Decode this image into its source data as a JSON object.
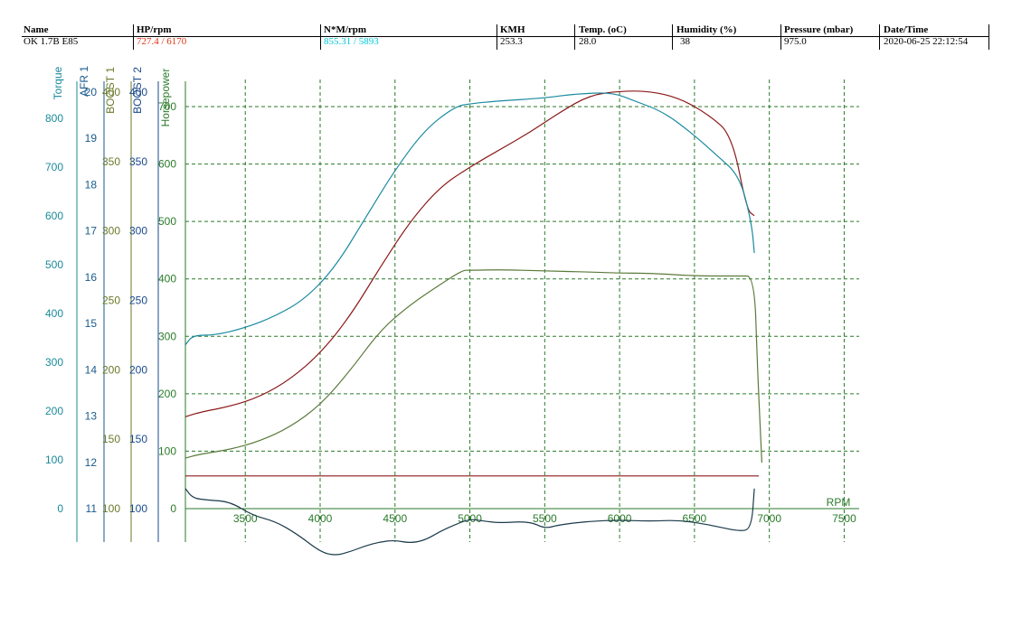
{
  "header": {
    "columns": [
      {
        "key": "name",
        "label": "Name",
        "value": "OK 1.7B E85",
        "value_color": "#000000"
      },
      {
        "key": "hp",
        "label": "HP/rpm",
        "value": "727.4 / 6170",
        "value_color": "#e03010"
      },
      {
        "key": "nm",
        "label": "N*M/rpm",
        "value": "855.31 / 5893",
        "value_color": "#00c8d8"
      },
      {
        "key": "kmh",
        "label": "KMH",
        "value": "253.3",
        "value_color": "#000000"
      },
      {
        "key": "temp",
        "label": "Temp. (oC)",
        "value": "28.0",
        "value_color": "#000000"
      },
      {
        "key": "hum",
        "label": "Humidity (%)",
        "value": "38",
        "value_color": "#000000"
      },
      {
        "key": "press",
        "label": "Pressure (mbar)",
        "value": "975.0",
        "value_color": "#000000"
      },
      {
        "key": "dt",
        "label": "Date/Time",
        "value": "2020-06-25 22:12:54",
        "value_color": "#000000"
      }
    ]
  },
  "colors": {
    "torque": "#1a8a9a",
    "afr": "#1a5a8a",
    "boost1": "#6a7a2a",
    "boost2": "#1a4a8a",
    "hp_axis": "#2a7a2a",
    "grid": "#2a7a2a",
    "hp_curve": "#8b1a1a",
    "torque_curve": "#1a8aa0",
    "boost_curve": "#5a7a3a",
    "afr_curve": "#1a3a4a"
  },
  "chart_data": {
    "type": "line",
    "xlabel": "RPM",
    "xlim": [
      3100,
      7600
    ],
    "x_ticks": [
      3500,
      4000,
      4500,
      5000,
      5500,
      6000,
      6500,
      7000,
      7500
    ],
    "grid": true,
    "axes": [
      {
        "key": "torque",
        "label": "Torque",
        "ticks": [
          0,
          100,
          200,
          300,
          400,
          500,
          600,
          700,
          800
        ],
        "range": [
          0,
          870
        ]
      },
      {
        "key": "afr",
        "label": "AFR 1",
        "ticks": [
          11,
          12,
          13,
          14,
          15,
          16,
          17,
          18,
          19,
          20
        ],
        "range": [
          11,
          20
        ]
      },
      {
        "key": "boost1",
        "label": "BOOST 1",
        "ticks": [
          100,
          150,
          200,
          250,
          300,
          350,
          400
        ],
        "range": [
          100,
          400
        ]
      },
      {
        "key": "boost2",
        "label": "BOOST 2",
        "ticks": [
          100,
          150,
          200,
          250,
          300,
          350,
          400
        ],
        "range": [
          100,
          400
        ]
      },
      {
        "key": "hp",
        "label": "Horsepower",
        "ticks": [
          0,
          100,
          200,
          300,
          400,
          500,
          600,
          700
        ],
        "range": [
          0,
          770
        ]
      }
    ],
    "series": [
      {
        "key": "hp_curve",
        "axis": "hp",
        "x": [
          3100,
          3200,
          3400,
          3600,
          3800,
          4000,
          4200,
          4400,
          4600,
          4800,
          5000,
          5200,
          5400,
          5600,
          5800,
          6000,
          6200,
          6400,
          6600,
          6750,
          6850,
          6900
        ],
        "y": [
          160,
          168,
          178,
          195,
          225,
          270,
          335,
          420,
          500,
          560,
          595,
          625,
          655,
          690,
          720,
          727,
          727,
          715,
          685,
          650,
          520,
          510
        ]
      },
      {
        "key": "torque_curve",
        "axis": "hp",
        "x": [
          3100,
          3150,
          3300,
          3500,
          3700,
          3900,
          4100,
          4300,
          4500,
          4700,
          4900,
          5000,
          5200,
          5500,
          5700,
          5950,
          6100,
          6300,
          6500,
          6650,
          6800,
          6880,
          6900
        ],
        "y": [
          285,
          302,
          302,
          315,
          335,
          365,
          420,
          505,
          590,
          660,
          700,
          705,
          710,
          715,
          722,
          725,
          710,
          690,
          650,
          615,
          580,
          500,
          445
        ]
      },
      {
        "key": "boost_curve",
        "axis": "hp",
        "x": [
          3100,
          3200,
          3400,
          3600,
          3800,
          4000,
          4200,
          4400,
          4600,
          4800,
          4950,
          5000,
          5200,
          5500,
          5800,
          6000,
          6200,
          6500,
          6800,
          6900,
          6920,
          6950
        ],
        "y": [
          88,
          95,
          103,
          118,
          142,
          180,
          240,
          310,
          355,
          390,
          415,
          415,
          416,
          414,
          412,
          410,
          410,
          405,
          405,
          405,
          250,
          80
        ]
      },
      {
        "key": "afr_curve",
        "axis": "hp",
        "x": [
          3100,
          3150,
          3250,
          3400,
          3550,
          3700,
          3850,
          4000,
          4100,
          4200,
          4300,
          4400,
          4500,
          4600,
          4700,
          4800,
          4900,
          5000,
          5100,
          5200,
          5400,
          5500,
          5600,
          5800,
          6000,
          6200,
          6400,
          6600,
          6800,
          6880,
          6900
        ],
        "y": [
          35,
          18,
          15,
          12,
          -12,
          -22,
          -45,
          -75,
          -82,
          -75,
          -65,
          -58,
          -55,
          -60,
          -55,
          -40,
          -28,
          -18,
          -22,
          -25,
          -22,
          -35,
          -28,
          -22,
          -20,
          -22,
          -20,
          -28,
          -40,
          -35,
          35
        ]
      },
      {
        "key": "ref_line",
        "axis": "hp",
        "x": [
          3100,
          6930
        ],
        "y": [
          57,
          57
        ]
      }
    ]
  }
}
